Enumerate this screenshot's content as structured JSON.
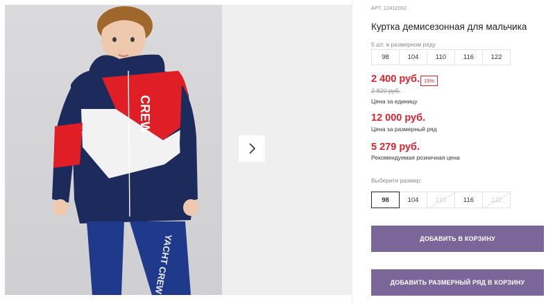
{
  "product": {
    "sku": "АРТ. 12412002",
    "title": "Куртка демисезонная для мальчика",
    "sizes_caption": "5 шт. в размерном ряду",
    "sizes_in_set": [
      "98",
      "104",
      "110",
      "116",
      "122"
    ],
    "price": "2 400 руб.",
    "discount": "15%",
    "old_price": "2 820 руб.",
    "price_caption": "Цена за единицу",
    "set_price": "12 000 руб.",
    "set_price_caption": "Цена за размерный ряд",
    "retail_price": "5 279 руб.",
    "retail_price_caption": "Рекомендуемая розничная цена",
    "choose_size_label": "Выберите размер:",
    "size_options": [
      {
        "label": "98",
        "state": "selected"
      },
      {
        "label": "104",
        "state": "available"
      },
      {
        "label": "110",
        "state": "unavailable"
      },
      {
        "label": "116",
        "state": "available"
      },
      {
        "label": "122",
        "state": "unavailable"
      }
    ]
  },
  "actions": {
    "add_to_cart": "ДОБАВИТЬ В КОРЗИНУ",
    "add_set_to_cart": "ДОБАВИТЬ РАЗМЕРНЫЙ РЯД В КОРЗИНУ"
  },
  "photo": {
    "jacket_print": "CREW",
    "pants_print": "YACHT CREW"
  },
  "colors": {
    "accent_red": "#d9232e",
    "button_purple": "#7b6699",
    "jacket_navy": "#1d2a5c",
    "jacket_red": "#e01e26"
  }
}
